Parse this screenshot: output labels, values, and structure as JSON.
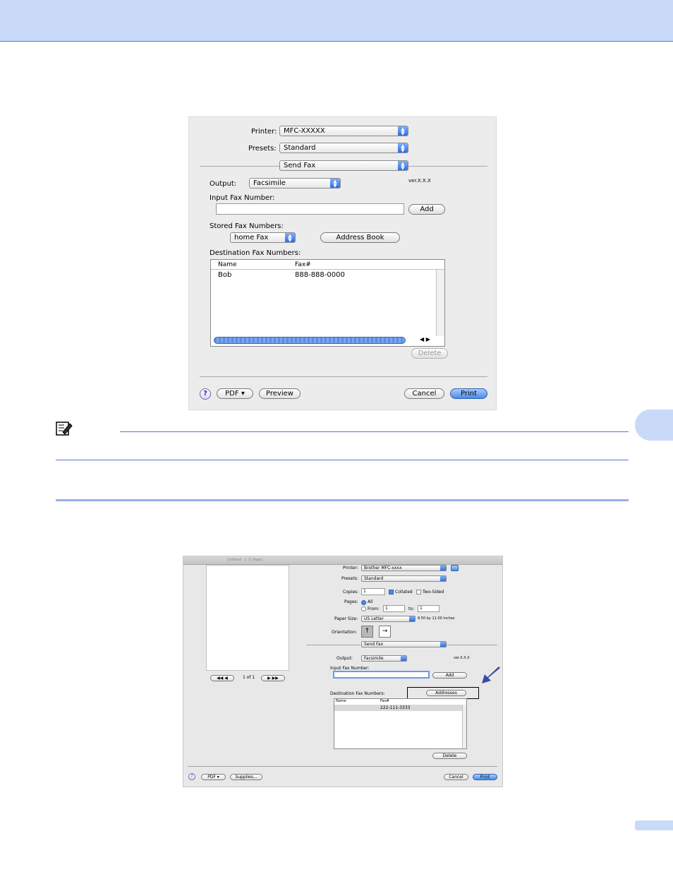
{
  "colors": {
    "band": "#c9daf8",
    "rule": "#5878c8",
    "default_button": "#4a8ae8",
    "arrow": "#3a4aa0"
  },
  "dialog1": {
    "printer_label": "Printer:",
    "printer_value": "MFC-XXXXX",
    "presets_label": "Presets:",
    "presets_value": "Standard",
    "panel_value": "Send Fax",
    "output_label": "Output:",
    "output_value": "Facsimile",
    "version": "ver.X.X.X",
    "input_fax_label": "Input Fax Number:",
    "input_fax_value": "",
    "add_button": "Add",
    "stored_label": "Stored Fax Numbers:",
    "stored_value": "home Fax",
    "address_book_button": "Address Book",
    "destination_label": "Destination Fax Numbers:",
    "columns": [
      "Name",
      "Fax#"
    ],
    "rows": [
      {
        "name": "Bob",
        "fax": "888-888-0000"
      }
    ],
    "delete_button": "Delete",
    "help_icon": "?",
    "pdf_button": "PDF ▾",
    "preview_button": "Preview",
    "cancel_button": "Cancel",
    "print_button": "Print"
  },
  "note_icon": "pencil-note-icon",
  "dialog2": {
    "window_title": "Untitled - 1 (1 Page)",
    "printer_label": "Printer:",
    "printer_value": "Brother MFC-xxxx",
    "presets_label": "Presets:",
    "presets_value": "Standard",
    "copies_label": "Copies:",
    "copies_value": "1",
    "collated_label": "Collated",
    "two_sided_label": "Two-Sided",
    "pages_label": "Pages:",
    "all_label": "All",
    "from_label": "From:",
    "from_value": "1",
    "to_label": "to:",
    "to_value": "1",
    "paper_size_label": "Paper Size:",
    "paper_size_value": "US Letter",
    "paper_dims": "8.50 by 11.00 inches",
    "orientation_label": "Orientation:",
    "panel_value": "Send Fax",
    "output_label": "Output:",
    "output_value": "Facsimile",
    "version": "ver.X.X.X",
    "input_fax_label": "Input Fax Number:",
    "add_button": "Add",
    "destination_label": "Destination Fax Numbers:",
    "addresses_button": "Addresses",
    "columns": [
      "Name",
      "Fax#"
    ],
    "rows": [
      {
        "name": "",
        "fax": "222-111-3333"
      }
    ],
    "delete_button": "Delete",
    "page_count": "1 of 1",
    "help_icon": "?",
    "pdf_button": "PDF ▾",
    "supplies_button": "Supplies...",
    "cancel_button": "Cancel",
    "print_button": "Print"
  }
}
